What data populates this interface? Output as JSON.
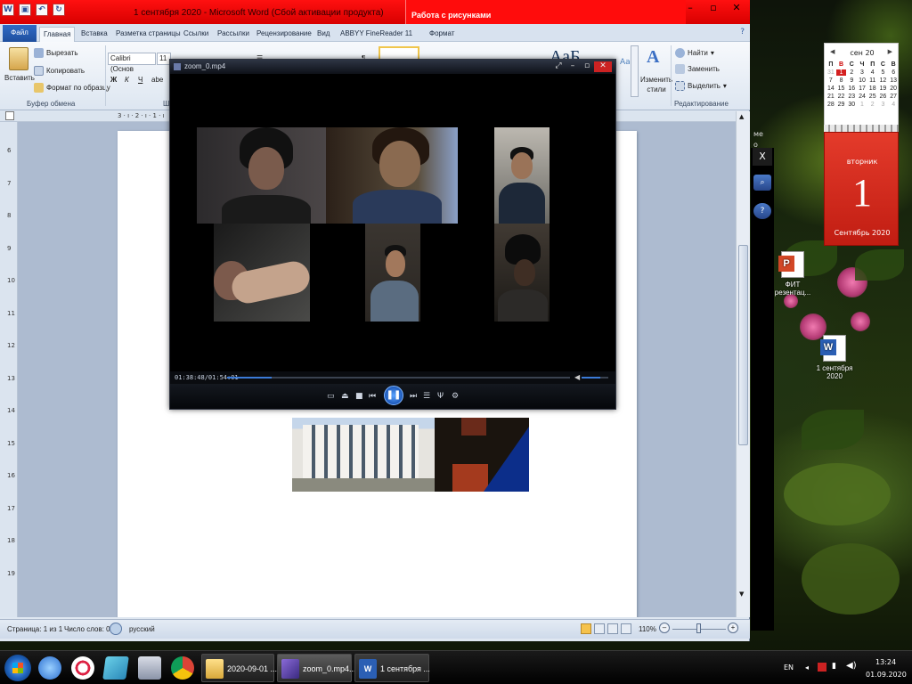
{
  "word": {
    "title": "1 сентября 2020 - Microsoft Word (Сбой активации продукта)",
    "contextual_tab_group": "Работа с рисунками",
    "tabs": [
      "Файл",
      "Главная",
      "Вставка",
      "Разметка страницы",
      "Ссылки",
      "Рассылки",
      "Рецензирование",
      "Вид",
      "ABBYY FineReader 11",
      "Формат"
    ],
    "active_tab": "Главная",
    "clipboard": {
      "paste": "Вставить",
      "cut": "Вырезать",
      "copy": "Копировать",
      "format_painter": "Формат по образцу",
      "group_label": "Буфер обмена"
    },
    "font": {
      "name": "Calibri (Основ",
      "size": "11",
      "bold": "Ж",
      "italic": "К",
      "underline": "Ч",
      "group_label_partial": "Ш"
    },
    "styles": {
      "preview_text": "АаБ",
      "preview_text2": "АаВ",
      "change_styles": "Изменить стили"
    },
    "editing": {
      "find": "Найти",
      "replace": "Заменить",
      "select": "Выделить",
      "group_label": "Редактирование"
    },
    "ruler_left_numbers": [
      "6",
      "7",
      "8",
      "9",
      "10",
      "11",
      "12",
      "13",
      "14",
      "15",
      "16",
      "17",
      "18",
      "19"
    ],
    "ruler_top_text": "3 · ı · 2 · ı · 1 · ı",
    "status": {
      "page": "Страница: 1 из 1",
      "words": "Число слов: 0",
      "language": "русский",
      "zoom": "110%"
    }
  },
  "player": {
    "title": "zoom_0.mp4",
    "timecode": "01:38:48/01:54:01",
    "progress_fraction": 0.13,
    "volume_fraction": 0.7,
    "play_glyph": "❚❚"
  },
  "calendar": {
    "month_header": "сен 20",
    "weekdays": [
      "П",
      "В",
      "С",
      "Ч",
      "П",
      "С",
      "В"
    ],
    "weeks": [
      [
        "31",
        "1",
        "2",
        "3",
        "4",
        "5",
        "6"
      ],
      [
        "7",
        "8",
        "9",
        "10",
        "11",
        "12",
        "13"
      ],
      [
        "14",
        "15",
        "16",
        "17",
        "18",
        "19",
        "20"
      ],
      [
        "21",
        "22",
        "23",
        "24",
        "25",
        "26",
        "27"
      ],
      [
        "28",
        "29",
        "30",
        "1",
        "2",
        "3",
        "4"
      ]
    ],
    "weekday_name": "вторник",
    "day": "1",
    "month_year": "Сентябрь 2020"
  },
  "side_panel": {
    "close": "X",
    "text_me": "ме",
    "text_o": "о"
  },
  "desktop_icons": [
    {
      "label1": "ФИТ",
      "label2": "резентац..."
    },
    {
      "label1": "1 сентября",
      "label2": "2020"
    }
  ],
  "taskbar": {
    "tasks": [
      "2020-09-01 ...",
      "zoom_0.mp4...",
      "1 сентября ..."
    ],
    "lang": "EN",
    "time": "13:24",
    "date": "01.09.2020"
  },
  "colors": {
    "word_titlebar": "#e00000",
    "calendar_red": "#d42020",
    "player_accent": "#3b7bd8"
  }
}
